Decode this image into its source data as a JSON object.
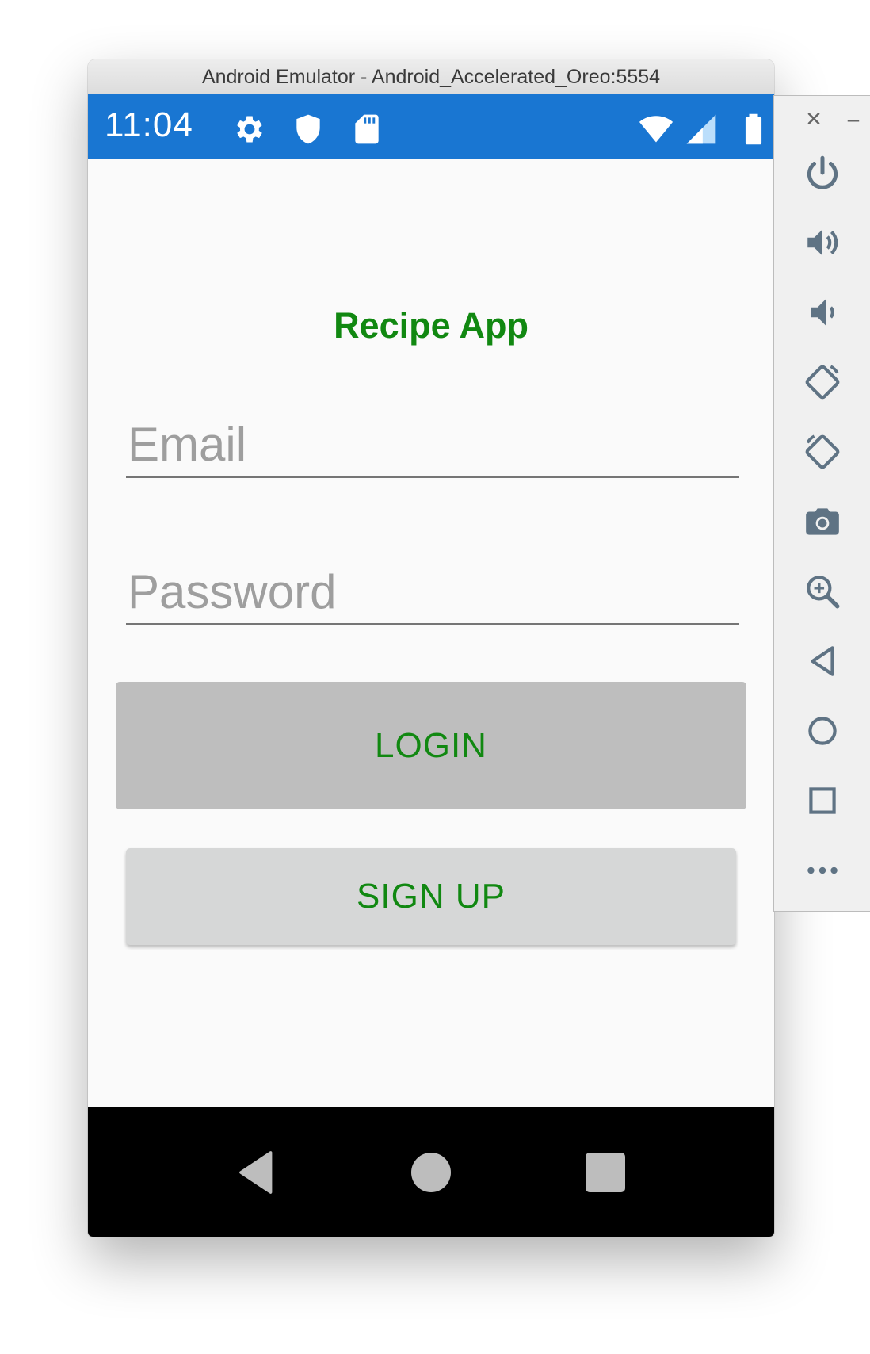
{
  "window": {
    "title": "Android Emulator - Android_Accelerated_Oreo:5554"
  },
  "status_bar": {
    "time": "11:04",
    "background": "#1976d2",
    "left_icons": [
      "settings-icon",
      "shield-icon",
      "sd-card-icon"
    ],
    "right_icons": [
      "wifi-icon",
      "cell-signal-icon",
      "battery-icon"
    ]
  },
  "app": {
    "title": "Recipe App",
    "accent_color": "#118811",
    "email_placeholder": "Email",
    "password_placeholder": "Password",
    "login_label": "LOGIN",
    "signup_label": "SIGN UP"
  },
  "nav_bar": {
    "buttons": [
      "back-icon",
      "home-icon",
      "recents-icon"
    ]
  },
  "side_panel": {
    "controls": [
      "close-icon",
      "minimize-icon"
    ],
    "tools": [
      "power-icon",
      "volume-up-icon",
      "volume-down-icon",
      "rotate-left-icon",
      "rotate-right-icon",
      "camera-icon",
      "zoom-icon",
      "back-icon",
      "home-icon",
      "overview-icon",
      "more-icon"
    ]
  }
}
